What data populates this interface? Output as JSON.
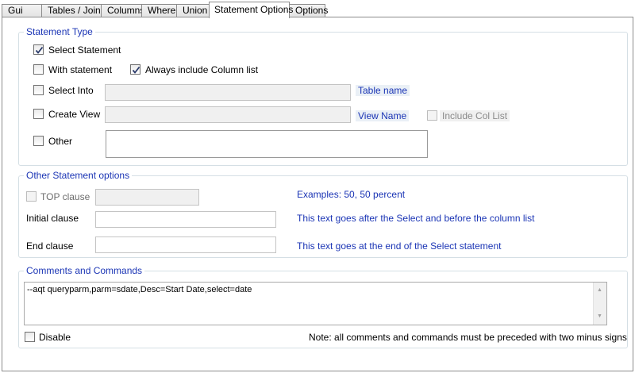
{
  "tabs": [
    {
      "label": "Gui",
      "active": false
    },
    {
      "label": "Tables / Joins",
      "active": false
    },
    {
      "label": "Columns",
      "active": false
    },
    {
      "label": "Where",
      "active": false
    },
    {
      "label": "Union",
      "active": false
    },
    {
      "label": "Statement Options",
      "active": true
    },
    {
      "label": "Options",
      "active": false
    }
  ],
  "statement_type": {
    "title": "Statement Type",
    "select_statement": {
      "label": "Select Statement",
      "checked": true
    },
    "with_statement": {
      "label": "With statement",
      "checked": false
    },
    "always_include": {
      "label": "Always include Column list",
      "checked": true
    },
    "select_into": {
      "label": "Select Into",
      "checked": false,
      "hint": "Table name"
    },
    "create_view": {
      "label": "Create View",
      "checked": false,
      "hint": "View Name"
    },
    "include_col_list": {
      "label": "Include Col List",
      "checked": false,
      "disabled": true
    },
    "other": {
      "label": "Other",
      "checked": false
    }
  },
  "other_options": {
    "title": "Other Statement options",
    "top_clause": {
      "label": "TOP clause",
      "checked": false,
      "disabled": true,
      "hint": "Examples: 50, 50 percent"
    },
    "initial_clause": {
      "label": "Initial clause",
      "value": "",
      "hint": "This text goes after the Select and before the column list"
    },
    "end_clause": {
      "label": "End clause",
      "value": "",
      "hint": "This text goes at the end of the Select statement"
    }
  },
  "comments": {
    "title": "Comments and Commands",
    "text": "--aqt queryparm,parm=sdate,Desc=Start Date,select=date",
    "disable": {
      "label": "Disable",
      "checked": false
    },
    "note": "Note: all comments and commands must be preceded with two minus signs"
  },
  "colors": {
    "accent_text": "#1b35b5",
    "group_border": "#d5dfe5"
  }
}
